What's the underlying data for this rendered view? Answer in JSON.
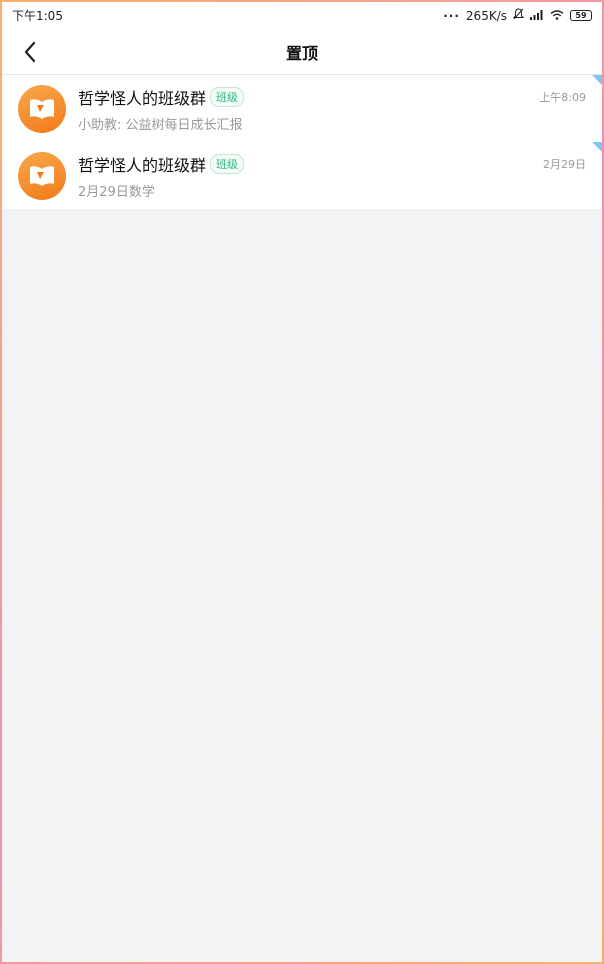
{
  "status_bar": {
    "time": "下午1:05",
    "net_speed": "265K/s",
    "battery": "59"
  },
  "header": {
    "title": "置顶"
  },
  "chats": [
    {
      "name": "哲学怪人的班级群",
      "badge": "班级",
      "time": "上午8:09",
      "preview": "小助教: 公益树每日成长汇报"
    },
    {
      "name": "哲学怪人的班级群",
      "badge": "班级",
      "time": "2月29日",
      "preview": "2月29日数学"
    }
  ],
  "colors": {
    "pin_marker": "#7ec8f0",
    "avatar": "#f27a1a",
    "badge": "#2fb87a"
  }
}
